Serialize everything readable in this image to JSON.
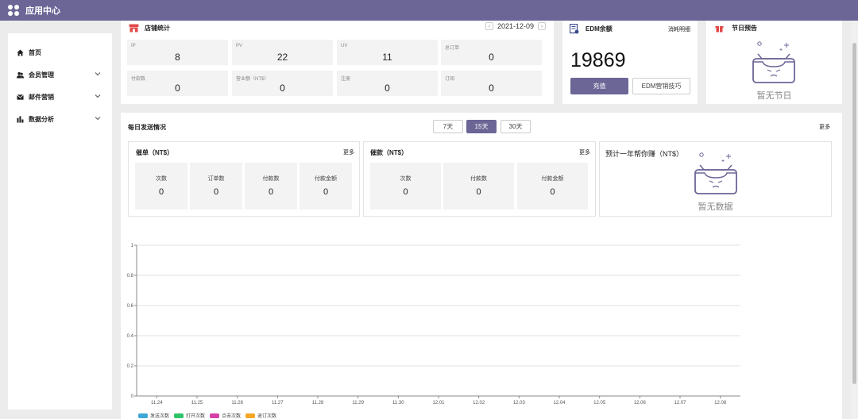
{
  "app": {
    "title": "应用中心"
  },
  "sidebar": {
    "items": [
      {
        "label": "首页"
      },
      {
        "label": "会员管理"
      },
      {
        "label": "邮件营销"
      },
      {
        "label": "数据分析"
      }
    ]
  },
  "store": {
    "title": "店铺统计",
    "date": "2021-12-09",
    "stats": [
      {
        "label": "IP",
        "value": "8"
      },
      {
        "label": "PV",
        "value": "22"
      },
      {
        "label": "UV",
        "value": "11"
      },
      {
        "label": "总订单",
        "value": "0"
      },
      {
        "label": "付款数",
        "value": "0"
      },
      {
        "label": "营业额（NT$）",
        "value": "0"
      },
      {
        "label": "注册",
        "value": "0"
      },
      {
        "label": "订阅",
        "value": "0"
      }
    ]
  },
  "edm": {
    "title": "EDM余额",
    "detail_link": "消耗明细",
    "balance": "19869",
    "recharge_label": "充值",
    "tips_label": "EDM营销技巧"
  },
  "holiday": {
    "title": "节日预告",
    "empty_text": "暂无节日"
  },
  "daily": {
    "title": "每日发送情况",
    "more": "更多",
    "ranges": [
      "7天",
      "15天",
      "30天"
    ],
    "active_range": "15天"
  },
  "unpaid": {
    "title": "催单（NT$）",
    "more": "更多",
    "items": [
      {
        "label": "次数",
        "value": "0"
      },
      {
        "label": "订单数",
        "value": "0"
      },
      {
        "label": "付款数",
        "value": "0"
      },
      {
        "label": "付款金额",
        "value": "0"
      }
    ]
  },
  "reminder": {
    "title": "催款（NT$）",
    "more": "更多",
    "items": [
      {
        "label": "次数",
        "value": "0"
      },
      {
        "label": "付款数",
        "value": "0"
      },
      {
        "label": "付款金额",
        "value": "0"
      }
    ]
  },
  "forecast": {
    "title": "预计一年帮你赚（NT$）",
    "empty_text": "暂无数据"
  },
  "chart_data": {
    "type": "line",
    "categories": [
      "11.24",
      "11.25",
      "11.26",
      "11.27",
      "11.28",
      "11.29",
      "11.30",
      "12.01",
      "12.02",
      "12.03",
      "12.04",
      "12.05",
      "12.06",
      "12.07",
      "12.08"
    ],
    "y_ticks": [
      "0",
      "0.2",
      "0.4",
      "0.6",
      "0.8",
      "1"
    ],
    "ylim": [
      0,
      1
    ],
    "grid": true,
    "legend_position": "bottom-left",
    "series": [
      {
        "name": "发送次数",
        "color": "#3fa7d6",
        "values": [
          0,
          0,
          0,
          0,
          0,
          0,
          0,
          0,
          0,
          0,
          0,
          0,
          0,
          0,
          0
        ]
      },
      {
        "name": "打开次数",
        "color": "#2ec46a",
        "values": [
          0,
          0,
          0,
          0,
          0,
          0,
          0,
          0,
          0,
          0,
          0,
          0,
          0,
          0,
          0
        ]
      },
      {
        "name": "点击次数",
        "color": "#d63fa7",
        "values": [
          0,
          0,
          0,
          0,
          0,
          0,
          0,
          0,
          0,
          0,
          0,
          0,
          0,
          0,
          0
        ]
      },
      {
        "name": "退订次数",
        "color": "#f5a623",
        "values": [
          0,
          0,
          0,
          0,
          0,
          0,
          0,
          0,
          0,
          0,
          0,
          0,
          0,
          0,
          0
        ]
      }
    ]
  }
}
